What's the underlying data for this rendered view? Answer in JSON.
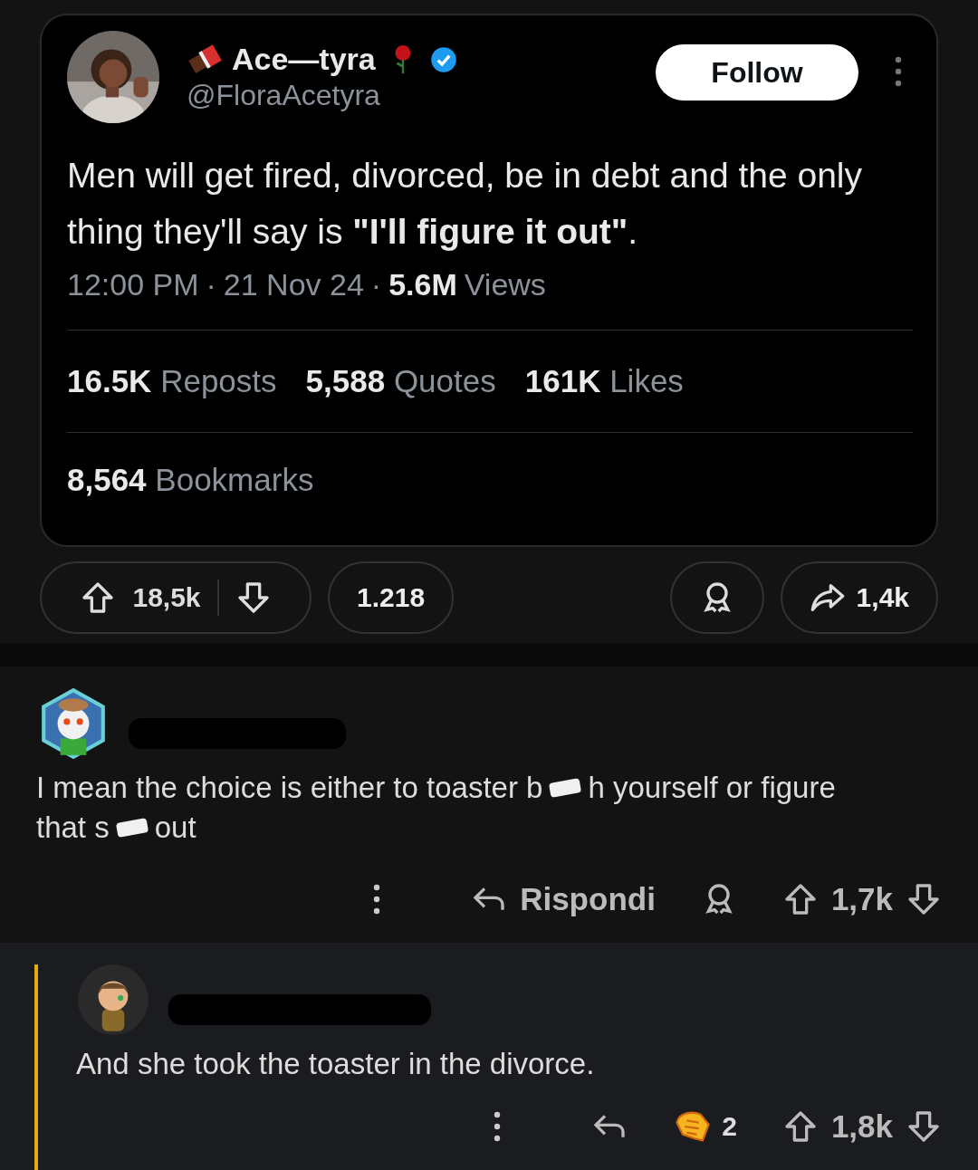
{
  "tweet": {
    "author": {
      "name": "Ace—tyra",
      "handle": "@FloraAcetyra",
      "verified": true
    },
    "follow_label": "Follow",
    "text": "Men will get fired, divorced, be in debt and the only thing they'll say is **\"I'll figure it out\"**.",
    "time": "12:00 PM",
    "date": "21 Nov 24",
    "views": "5.6M",
    "views_label": "Views",
    "separator": "·",
    "stats": [
      {
        "count": "16.5K",
        "label": "Reposts"
      },
      {
        "count": "5,588",
        "label": "Quotes"
      },
      {
        "count": "161K",
        "label": "Likes"
      }
    ],
    "bookmarks": {
      "count": "8,564",
      "label": "Bookmarks"
    }
  },
  "post_actions": {
    "upvotes": "18,5k",
    "comments": "1.218",
    "shares": "1,4k"
  },
  "comments": [
    {
      "body_lines": [
        [
          "I mean the choice is either to toaster b",
          "h yourself or figure"
        ],
        [
          "that s",
          "out"
        ]
      ],
      "reply_label": "Rispondi",
      "votes": "1,7k"
    },
    {
      "body_lines": [
        [
          "And she took the toaster in the divorce."
        ]
      ],
      "votes": "1,8k",
      "award_count": "2"
    }
  ]
}
